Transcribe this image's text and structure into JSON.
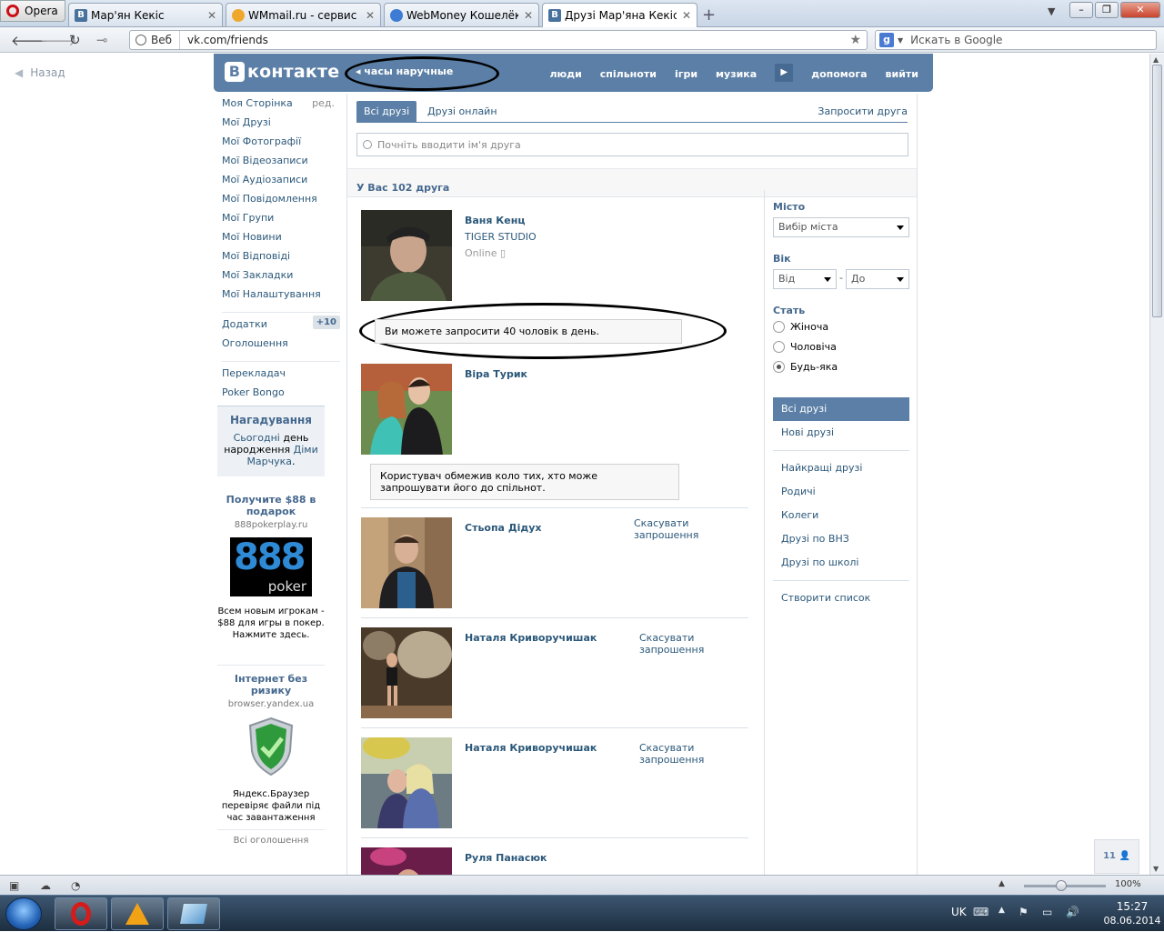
{
  "browser": {
    "menu_label": "Opera",
    "tabs": [
      {
        "label": "Мар'ян Кекіс",
        "favicon": "В"
      },
      {
        "label": "WMmail.ru - сервис п...",
        "favicon": ""
      },
      {
        "label": "WebMoney Кошелёк »...",
        "favicon": ""
      },
      {
        "label": "Друзі Мар'яна Кекіса |...",
        "favicon": "В"
      }
    ],
    "url_chip": "Веб",
    "url": "vk.com/friends",
    "search_placeholder": "Искать в Google",
    "search_engine_icon": "g-icon"
  },
  "page": {
    "back_label": "Назад",
    "logo_text": "контакте",
    "logo_letter": "В",
    "header_search": "часы наручные",
    "top_menu": [
      "люди",
      "спільноти",
      "ігри",
      "музика",
      "допомога",
      "вийти"
    ],
    "left_menu": [
      "Моя Сторінка",
      "Мої Друзі",
      "Мої Фотографії",
      "Мої Відеозаписи",
      "Мої Аудіозаписи",
      "Мої Повідомлення",
      "Мої Групи",
      "Мої Новини",
      "Мої Відповіді",
      "Мої Закладки",
      "Мої Налаштування"
    ],
    "left_menu_edit": "ред.",
    "left_menu_apps": "Додатки",
    "left_menu_apps_badge": "+10",
    "left_menu_ads": "Оголошення",
    "left_menu_translator": "Перекладач",
    "left_menu_poker": "Poker Bongo",
    "reminder": {
      "title": "Нагадування",
      "t1": "Сьогодні",
      "t2": " день народження ",
      "t3": "Діми Марчука",
      "t4": "."
    },
    "ad1": {
      "title": "Получите $88 в подарок",
      "domain": "888pokerplay.ru",
      "logo_num": "888",
      "logo_word": "poker",
      "text": "Всем новым игрокам - $88 для игры в покер. Нажмите здесь."
    },
    "ad2": {
      "title": "Інтернет без ризику",
      "domain": "browser.yandex.ua",
      "text": "Яндекс.Браузер перевіряє файли під час завантаження"
    },
    "all_ads": "Всі оголошення",
    "tabs": {
      "all": "Всі друзі",
      "online": "Друзі онлайн",
      "invite": "Запросити друга"
    },
    "friend_search_placeholder": "Почніть вводити ім'я друга",
    "summary": "У Вас 102 друга",
    "friends": [
      {
        "name": "Ваня Кенц",
        "sub": "TIGER STUDIO",
        "status": "Online",
        "action": ""
      },
      {
        "name": "Віра Турик",
        "sub": "",
        "status": "",
        "action": ""
      },
      {
        "name": "Стьопа Дідух",
        "sub": "",
        "status": "",
        "action": "Скасувати запрошення"
      },
      {
        "name": "Наталя Криворучишак",
        "sub": "",
        "status": "",
        "action": "Скасувати запрошення"
      },
      {
        "name": "Наталя Криворучишак",
        "sub": "",
        "status": "",
        "action": "Скасувати запрошення"
      },
      {
        "name": "Руля Панасюк",
        "sub": "",
        "status": "",
        "action": ""
      }
    ],
    "notice1": "Ви можете запросити 40 чоловік в день.",
    "notice2": "Користувач обмежив коло тих, хто може запрошувати його до спільнот.",
    "filters": {
      "city_label": "Місто",
      "city_value": "Вибір міста",
      "age_label": "Вік",
      "age_from": "Від",
      "age_to": "До",
      "sex_label": "Стать",
      "sex_options": [
        "Жіноча",
        "Чоловіча",
        "Будь-яка"
      ],
      "sex_selected": "Будь-яка"
    },
    "categories": [
      "Всі друзі",
      "Нові друзі",
      "Найкращі друзі",
      "Родичі",
      "Колеги",
      "Друзі по ВНЗ",
      "Друзі по школі",
      "Створити список"
    ],
    "counter": "11"
  },
  "status_bar": {
    "zoom": "100%"
  },
  "taskbar": {
    "lang": "UK",
    "time": "15:27",
    "date": "08.06.2014"
  },
  "colors": {
    "vk_blue": "#5b7fa6",
    "vk_link": "#2b587a",
    "vk_title": "#45688e"
  }
}
